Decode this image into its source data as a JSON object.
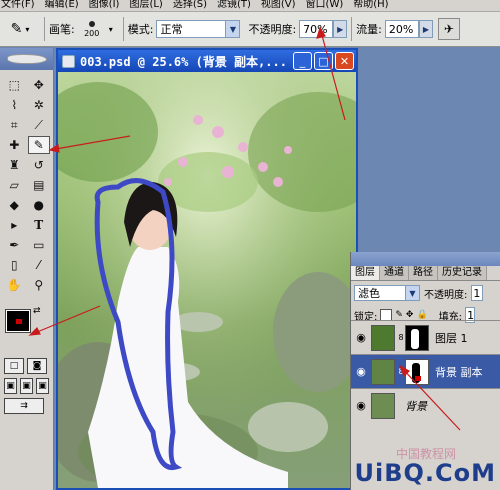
{
  "menubar": {
    "items": [
      "文件(F)",
      "编辑(E)",
      "图像(I)",
      "图层(L)",
      "选择(S)",
      "滤镜(T)",
      "视图(V)",
      "窗口(W)",
      "帮助(H)"
    ]
  },
  "options": {
    "brush_label": "画笔:",
    "brush_size": "200",
    "mode_label": "模式:",
    "mode_value": "正常",
    "opacity_label": "不透明度:",
    "opacity_value": "70%",
    "flow_label": "流量:",
    "flow_value": "20%"
  },
  "document": {
    "title": "003.psd @ 25.6% (背景 副本,..."
  },
  "layers_panel": {
    "tabs": [
      "图层",
      "通道",
      "路径",
      "历史记录"
    ],
    "blend_mode": "滤色",
    "opacity_label": "不透明度:",
    "opacity_value": "1",
    "lock_label": "锁定:",
    "fill_label": "填充:",
    "fill_value": "1",
    "layers": [
      {
        "name": "图层 1",
        "selected": false
      },
      {
        "name": "背景 副本",
        "selected": true
      },
      {
        "name": "背景",
        "selected": false
      }
    ]
  },
  "watermark": {
    "brand": "UiBQ.CoM",
    "cn": "中国教程网"
  },
  "colors": {
    "foreground": "#000000",
    "background": "#ffffff",
    "accent": "#1b4fb8"
  }
}
